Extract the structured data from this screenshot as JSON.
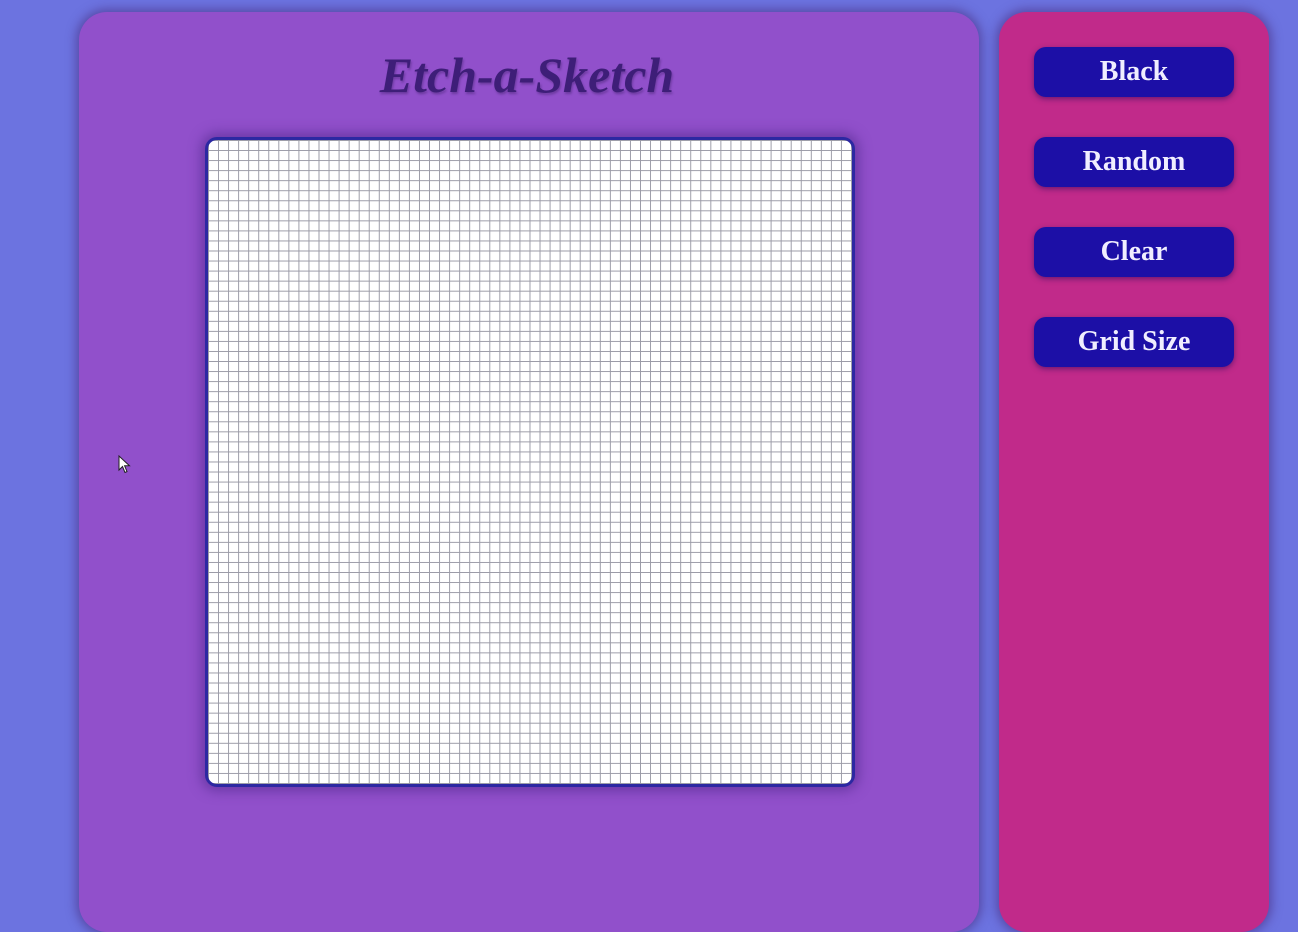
{
  "app": {
    "title": "Etch-a-Sketch"
  },
  "grid": {
    "rows": 64,
    "columns": 64,
    "cell_color": "#ffffff",
    "line_color": "#9a9aa6"
  },
  "controls": {
    "black_label": "Black",
    "random_label": "Random",
    "clear_label": "Clear",
    "grid_size_label": "Grid Size"
  },
  "colors": {
    "background": "#6c73e0",
    "main_panel": "#9150cb",
    "side_panel": "#c12a8a",
    "button": "#1c0fa6",
    "title": "#3e1e78",
    "board_border": "#2c28a2"
  },
  "icons": {
    "cursor": "mouse-pointer-icon"
  }
}
